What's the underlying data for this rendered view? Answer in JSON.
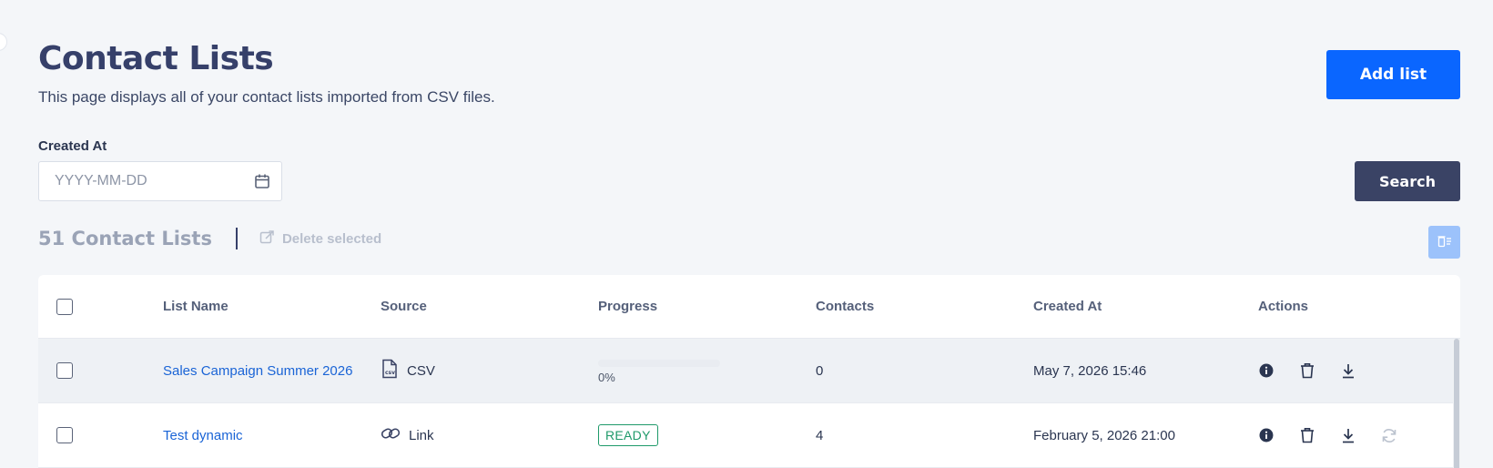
{
  "header": {
    "title": "Contact Lists",
    "subtitle": "This page displays all of your contact lists imported from CSV files.",
    "add_label": "Add list"
  },
  "filter": {
    "label": "Created At",
    "placeholder": "YYYY-MM-DD",
    "search_label": "Search"
  },
  "summary": {
    "count_title": "51 Contact Lists",
    "delete_selected_label": "Delete selected"
  },
  "table": {
    "columns": [
      "List Name",
      "Source",
      "Progress",
      "Contacts",
      "Created At",
      "Actions"
    ],
    "rows": [
      {
        "name": "Sales Campaign Summer 2026",
        "source": "CSV",
        "source_icon": "csv-file-icon",
        "progress_percent": 0,
        "progress_label": "0%",
        "contacts": "0",
        "created_at": "May 7, 2026 15:46"
      },
      {
        "name": "Test dynamic",
        "source": "Link",
        "source_icon": "link-icon",
        "status": "READY",
        "contacts": "4",
        "created_at": "February 5, 2026 21:00"
      }
    ]
  },
  "colors": {
    "primary": "#0a66ff",
    "dark_button": "#3a4365",
    "title": "#36406a",
    "link": "#1a64d6",
    "ready": "#1f9a6a"
  }
}
